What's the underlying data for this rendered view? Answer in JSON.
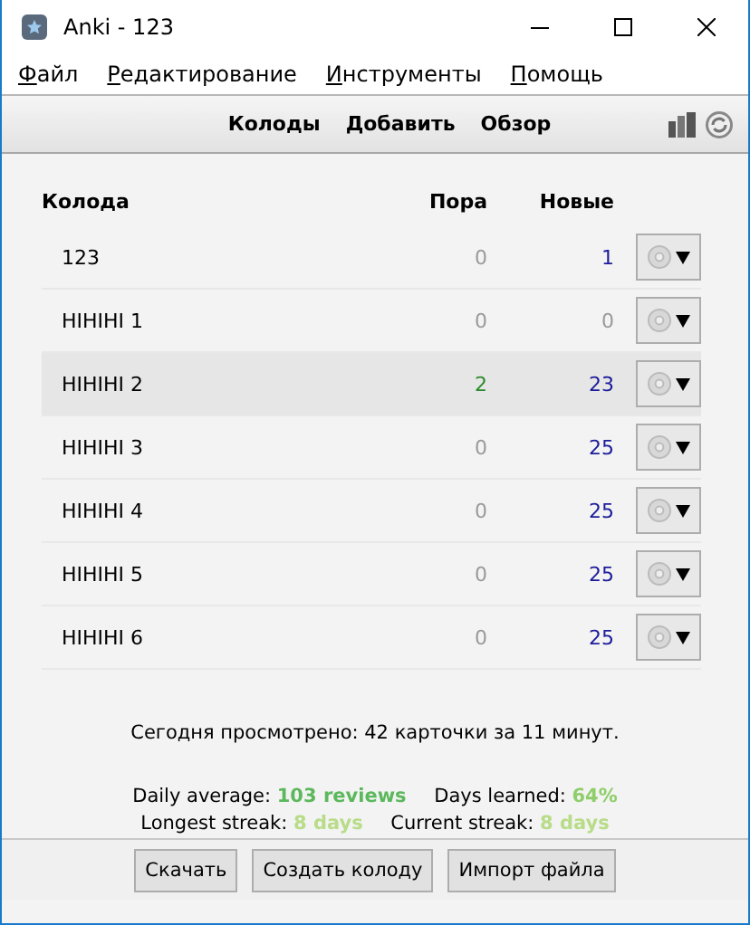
{
  "window": {
    "title": "Anki - 123"
  },
  "menu": [
    "Файл",
    "Редактирование",
    "Инструменты",
    "Помощь"
  ],
  "toolbar": [
    "Колоды",
    "Добавить",
    "Обзор"
  ],
  "table": {
    "columns": [
      "Колода",
      "Пора",
      "Новые"
    ],
    "rows": [
      {
        "name": "123",
        "due": "0",
        "due_muted": true,
        "new": "1",
        "new_muted": false,
        "selected": false
      },
      {
        "name": "HIHIHI 1",
        "due": "0",
        "due_muted": true,
        "new": "0",
        "new_muted": true,
        "selected": false
      },
      {
        "name": "HIHIHI 2",
        "due": "2",
        "due_muted": false,
        "new": "23",
        "new_muted": false,
        "selected": true
      },
      {
        "name": "HIHIHI 3",
        "due": "0",
        "due_muted": true,
        "new": "25",
        "new_muted": false,
        "selected": false
      },
      {
        "name": "HIHIHI 4",
        "due": "0",
        "due_muted": true,
        "new": "25",
        "new_muted": false,
        "selected": false
      },
      {
        "name": "HIHIHI 5",
        "due": "0",
        "due_muted": true,
        "new": "25",
        "new_muted": false,
        "selected": false
      },
      {
        "name": "HIHIHI 6",
        "due": "0",
        "due_muted": true,
        "new": "25",
        "new_muted": false,
        "selected": false
      }
    ]
  },
  "summary": "Сегодня просмотрено: 42 карточки за 11 минут.",
  "stats": [
    {
      "label": "Daily average:",
      "value": "103 reviews",
      "color": "#5cb85c"
    },
    {
      "label": "Days learned:",
      "value": "64%",
      "color": "#8fce6a"
    },
    {
      "label": "Longest streak:",
      "value": "8 days",
      "color": "#b8dc88"
    },
    {
      "label": "Current streak:",
      "value": "8 days",
      "color": "#b8dc88"
    }
  ],
  "buttons": [
    "Скачать",
    "Создать колоду",
    "Импорт файла"
  ]
}
